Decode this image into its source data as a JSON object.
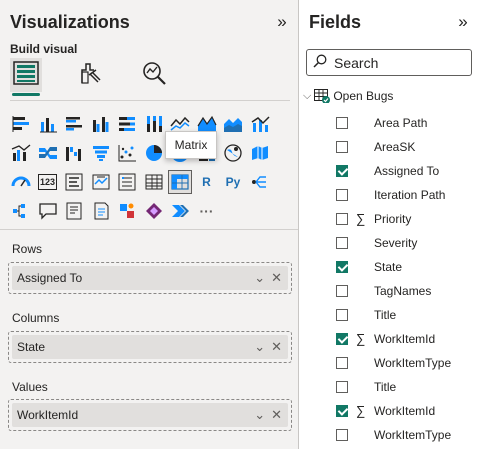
{
  "visualizations": {
    "title": "Visualizations",
    "collapse_icon": "double-chevron-right-icon",
    "build_label": "Build visual",
    "mode_tabs": [
      {
        "icon": "build-visual-icon",
        "active": true
      },
      {
        "icon": "format-visual-icon",
        "active": false
      },
      {
        "icon": "analytics-icon",
        "active": false
      }
    ],
    "icons": [
      {
        "name": "stacked-bar-chart-icon"
      },
      {
        "name": "stacked-column-chart-icon"
      },
      {
        "name": "clustered-bar-chart-icon"
      },
      {
        "name": "clustered-column-chart-icon"
      },
      {
        "name": "100-stacked-bar-chart-icon"
      },
      {
        "name": "100-stacked-column-chart-icon"
      },
      {
        "name": "line-chart-icon"
      },
      {
        "name": "area-chart-icon"
      },
      {
        "name": "stacked-area-chart-icon"
      },
      {
        "name": "line-stacked-column-chart-icon"
      },
      {
        "name": "line-clustered-column-chart-icon"
      },
      {
        "name": "ribbon-chart-icon"
      },
      {
        "name": "waterfall-chart-icon"
      },
      {
        "name": "funnel-chart-icon"
      },
      {
        "name": "scatter-chart-icon"
      },
      {
        "name": "pie-chart-icon"
      },
      {
        "name": "donut-chart-icon"
      },
      {
        "name": "treemap-icon"
      },
      {
        "name": "map-icon"
      },
      {
        "name": "filled-map-icon"
      },
      {
        "name": "gauge-icon"
      },
      {
        "name": "card-icon",
        "text": "123"
      },
      {
        "name": "multi-row-card-icon"
      },
      {
        "name": "kpi-icon"
      },
      {
        "name": "slicer-icon"
      },
      {
        "name": "table-icon"
      },
      {
        "name": "matrix-icon",
        "selected": true
      },
      {
        "name": "r-visual-icon",
        "text": "R"
      },
      {
        "name": "python-visual-icon",
        "text": "Py"
      },
      {
        "name": "key-influencers-icon"
      },
      {
        "name": "decomposition-tree-icon"
      },
      {
        "name": "qa-icon"
      },
      {
        "name": "smart-narrative-icon"
      },
      {
        "name": "paginated-report-icon"
      },
      {
        "name": "azure-map-icon"
      },
      {
        "name": "power-apps-icon"
      },
      {
        "name": "power-automate-icon"
      },
      {
        "name": "more-visuals-icon",
        "text": "···"
      }
    ],
    "tooltip": "Matrix",
    "wells": [
      {
        "label": "Rows",
        "value": "Assigned To"
      },
      {
        "label": "Columns",
        "value": "State"
      },
      {
        "label": "Values",
        "value": "WorkItemId"
      }
    ],
    "chip_icons": [
      "chevron-down-icon",
      "close-icon"
    ]
  },
  "fields": {
    "title": "Fields",
    "collapse_icon": "double-chevron-right-icon",
    "search_placeholder": "Search",
    "table_name": "Open Bugs",
    "items": [
      {
        "name": "Area Path",
        "checked": false,
        "sigma": false
      },
      {
        "name": "AreaSK",
        "checked": false,
        "sigma": false
      },
      {
        "name": "Assigned To",
        "checked": true,
        "sigma": false
      },
      {
        "name": "Iteration Path",
        "checked": false,
        "sigma": false
      },
      {
        "name": "Priority",
        "checked": false,
        "sigma": true
      },
      {
        "name": "Severity",
        "checked": false,
        "sigma": false
      },
      {
        "name": "State",
        "checked": true,
        "sigma": false
      },
      {
        "name": "TagNames",
        "checked": false,
        "sigma": false
      },
      {
        "name": "Title",
        "checked": false,
        "sigma": false
      },
      {
        "name": "WorkItemId",
        "checked": true,
        "sigma": true
      },
      {
        "name": "WorkItemType",
        "checked": false,
        "sigma": false
      },
      {
        "name": "Title",
        "checked": false,
        "sigma": false
      },
      {
        "name": "WorkItemId",
        "checked": true,
        "sigma": true
      },
      {
        "name": "WorkItemType",
        "checked": false,
        "sigma": false
      }
    ]
  },
  "colors": {
    "accent": "#117865",
    "icon_blue": "#1f6fb2",
    "icon_teal": "#118dff"
  }
}
